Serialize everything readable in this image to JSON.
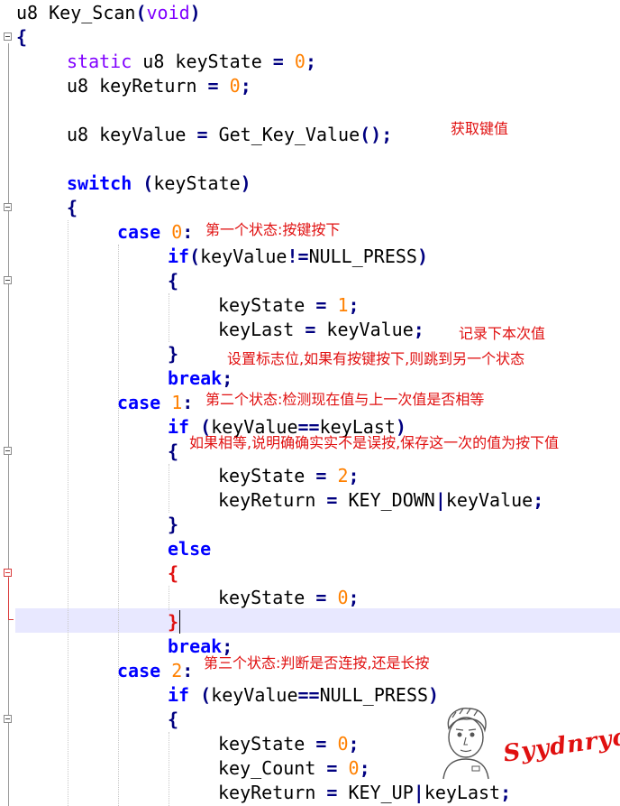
{
  "editor": {
    "lines": {
      "l1": {
        "a": "u8 Key_Scan",
        "b": "(",
        "c": "void",
        "d": ")"
      },
      "l2": {
        "a": "{"
      },
      "l3": {
        "a": "static",
        "b": " u8 keyState ",
        "c": "=",
        "d": " ",
        "e": "0",
        "f": ";"
      },
      "l4": {
        "a": "u8 keyReturn ",
        "b": "=",
        "c": " ",
        "d": "0",
        "e": ";"
      },
      "l6": {
        "a": "u8 keyValue ",
        "b": "=",
        "c": " Get_Key_Value",
        "d": "();"
      },
      "l8": {
        "a": "switch",
        "b": " (",
        "c": "keyState",
        "d": ")"
      },
      "l9": {
        "a": "{"
      },
      "l10": {
        "a": "case",
        "b": " ",
        "c": "0",
        "d": ":"
      },
      "l11": {
        "a": "if",
        "b": "(",
        "c": "keyValue",
        "d": "!=",
        "e": "NULL_PRESS",
        "f": ")"
      },
      "l12": {
        "a": "{"
      },
      "l13": {
        "a": "keyState ",
        "b": "=",
        "c": " ",
        "d": "1",
        "e": ";"
      },
      "l14": {
        "a": "keyLast ",
        "b": "=",
        "c": " keyValue",
        "d": ";"
      },
      "l15": {
        "a": "}"
      },
      "l16": {
        "a": "break",
        "b": ";"
      },
      "l17": {
        "a": "case",
        "b": " ",
        "c": "1",
        "d": ":"
      },
      "l18": {
        "a": "if",
        "b": " (",
        "c": "keyValue",
        "d": "==",
        "e": "keyLast",
        "f": ")"
      },
      "l19": {
        "a": "{"
      },
      "l20": {
        "a": "keyState ",
        "b": "=",
        "c": " ",
        "d": "2",
        "e": ";"
      },
      "l21": {
        "a": "keyReturn ",
        "b": "=",
        "c": " KEY_DOWN",
        "d": "|",
        "e": "keyValue",
        "f": ";"
      },
      "l22": {
        "a": "}"
      },
      "l23": {
        "a": "else"
      },
      "l24": {
        "a": "{"
      },
      "l25": {
        "a": "keyState ",
        "b": "=",
        "c": " ",
        "d": "0",
        "e": ";"
      },
      "l26": {
        "a": "}"
      },
      "l27": {
        "a": "break",
        "b": ";"
      },
      "l28": {
        "a": "case",
        "b": " ",
        "c": "2",
        "d": ":"
      },
      "l29": {
        "a": "if",
        "b": " (",
        "c": "keyValue",
        "d": "==",
        "e": "NULL_PRESS",
        "f": ")"
      },
      "l30": {
        "a": "{"
      },
      "l31": {
        "a": "keyState ",
        "b": "=",
        "c": " ",
        "d": "0",
        "e": ";"
      },
      "l32": {
        "a": "key_Count ",
        "b": "=",
        "c": " ",
        "d": "0",
        "e": ";"
      },
      "l33": {
        "a": "keyReturn ",
        "b": "=",
        "c": " KEY_UP",
        "d": "|",
        "e": "keyLast",
        "f": ";"
      }
    }
  },
  "annotations": {
    "get_value": "获取键值",
    "state0": "第一个状态:按键按下",
    "record": "记录下本次值",
    "set_flag": "设置标志位,如果有按键按下,则跳到另一个状态",
    "state1": "第二个状态:检测现在值与上一次值是否相等",
    "if_equal": "如果相等,说明确确实实不是误按,保存这一次的值为按下值",
    "state2": "第三个状态:判断是否连按,还是长按"
  },
  "watermark": {
    "text": "Syydnrycx"
  },
  "colors": {
    "keyword": "#0000ff",
    "type": "#8000ff",
    "number": "#ff8000",
    "operator": "#000080",
    "annotation": "#e01010",
    "current_line": "#e8e8ff"
  }
}
